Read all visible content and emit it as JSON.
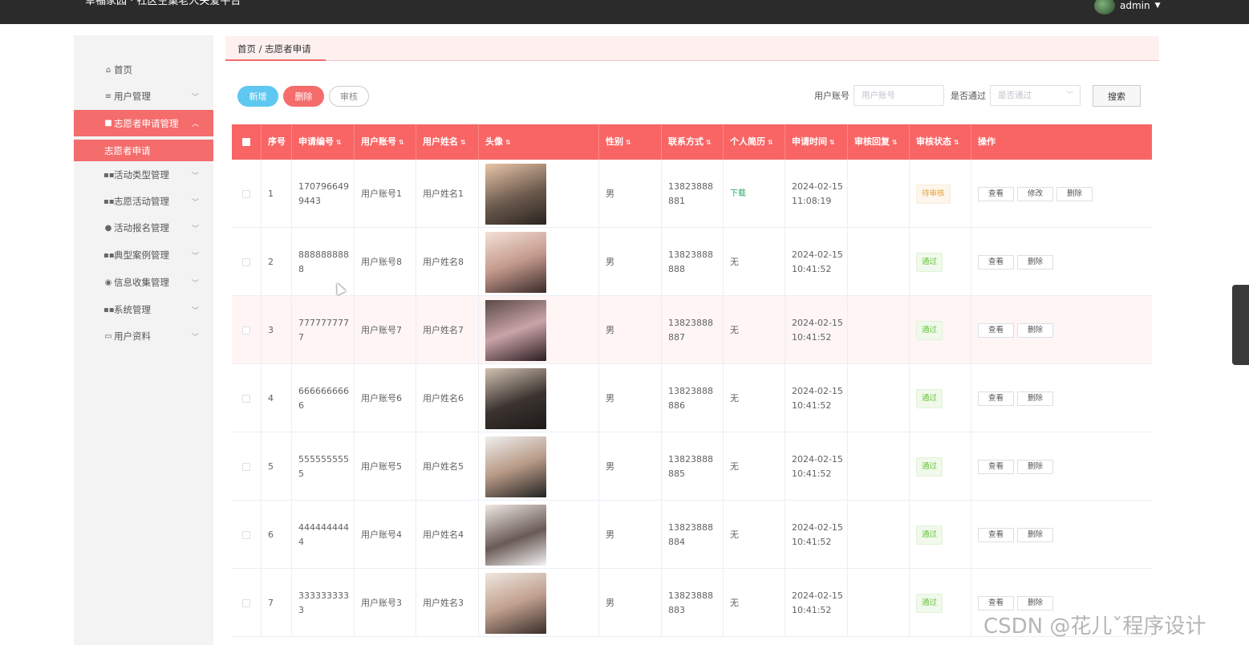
{
  "header": {
    "title": "幸福家园 · 社区空巢老人关爱平台",
    "user": "admin"
  },
  "sidebar": {
    "items": [
      {
        "label": "首页",
        "icon": "home-icon"
      },
      {
        "label": "用户管理",
        "icon": "list-icon"
      },
      {
        "label": "志愿者申请管理",
        "icon": "doc-icon"
      },
      {
        "label": "活动类型管理",
        "icon": "grid-icon"
      },
      {
        "label": "志愿活动管理",
        "icon": "grid-icon"
      },
      {
        "label": "活动报名管理",
        "icon": "user-icon"
      },
      {
        "label": "典型案例管理",
        "icon": "grid-icon"
      },
      {
        "label": "信息收集管理",
        "icon": "pin-icon"
      },
      {
        "label": "系统管理",
        "icon": "grid-icon"
      },
      {
        "label": "用户资料",
        "icon": "card-icon"
      }
    ],
    "active_sub": "志愿者申请"
  },
  "breadcrumb": "首页 / 志愿者申请",
  "toolbar": {
    "add": "新增",
    "delete": "删除",
    "audit": "审核"
  },
  "search": {
    "account_label": "用户账号",
    "account_placeholder": "用户账号",
    "pass_label": "是否通过",
    "pass_placeholder": "是否通过",
    "button": "搜索"
  },
  "table": {
    "headers": [
      "序号",
      "申请编号",
      "用户账号",
      "用户姓名",
      "头像",
      "性别",
      "联系方式",
      "个人简历",
      "申请时间",
      "审核回复",
      "审核状态",
      "操作"
    ],
    "rows": [
      {
        "idx": "1",
        "no": "1707966499443",
        "account": "用户账号1",
        "name": "用户姓名1",
        "gender": "男",
        "phone": "13823888881",
        "resume": "下载",
        "time": "2024-02-15 11:08:19",
        "reply": "",
        "status": "待审核"
      },
      {
        "idx": "2",
        "no": "8888888888",
        "account": "用户账号8",
        "name": "用户姓名8",
        "gender": "男",
        "phone": "13823888888",
        "resume": "无",
        "time": "2024-02-15 10:41:52",
        "reply": "",
        "status": "通过"
      },
      {
        "idx": "3",
        "no": "7777777777",
        "account": "用户账号7",
        "name": "用户姓名7",
        "gender": "男",
        "phone": "13823888887",
        "resume": "无",
        "time": "2024-02-15 10:41:52",
        "reply": "",
        "status": "通过"
      },
      {
        "idx": "4",
        "no": "6666666666",
        "account": "用户账号6",
        "name": "用户姓名6",
        "gender": "男",
        "phone": "13823888886",
        "resume": "无",
        "time": "2024-02-15 10:41:52",
        "reply": "",
        "status": "通过"
      },
      {
        "idx": "5",
        "no": "5555555555",
        "account": "用户账号5",
        "name": "用户姓名5",
        "gender": "男",
        "phone": "13823888885",
        "resume": "无",
        "time": "2024-02-15 10:41:52",
        "reply": "",
        "status": "通过"
      },
      {
        "idx": "6",
        "no": "4444444444",
        "account": "用户账号4",
        "name": "用户姓名4",
        "gender": "男",
        "phone": "13823888884",
        "resume": "无",
        "time": "2024-02-15 10:41:52",
        "reply": "",
        "status": "通过"
      },
      {
        "idx": "7",
        "no": "3333333333",
        "account": "用户账号3",
        "name": "用户姓名3",
        "gender": "男",
        "phone": "13823888883",
        "resume": "无",
        "time": "2024-02-15 10:41:52",
        "reply": "",
        "status": "通过"
      }
    ],
    "ops": {
      "view": "查看",
      "edit": "修改",
      "del": "删除"
    }
  },
  "watermark": "CSDN @花儿ˇ程序设计",
  "colors": {
    "accent": "#f56c6c",
    "header_bg": "#f96565",
    "topbar": "#2b2b2b"
  }
}
